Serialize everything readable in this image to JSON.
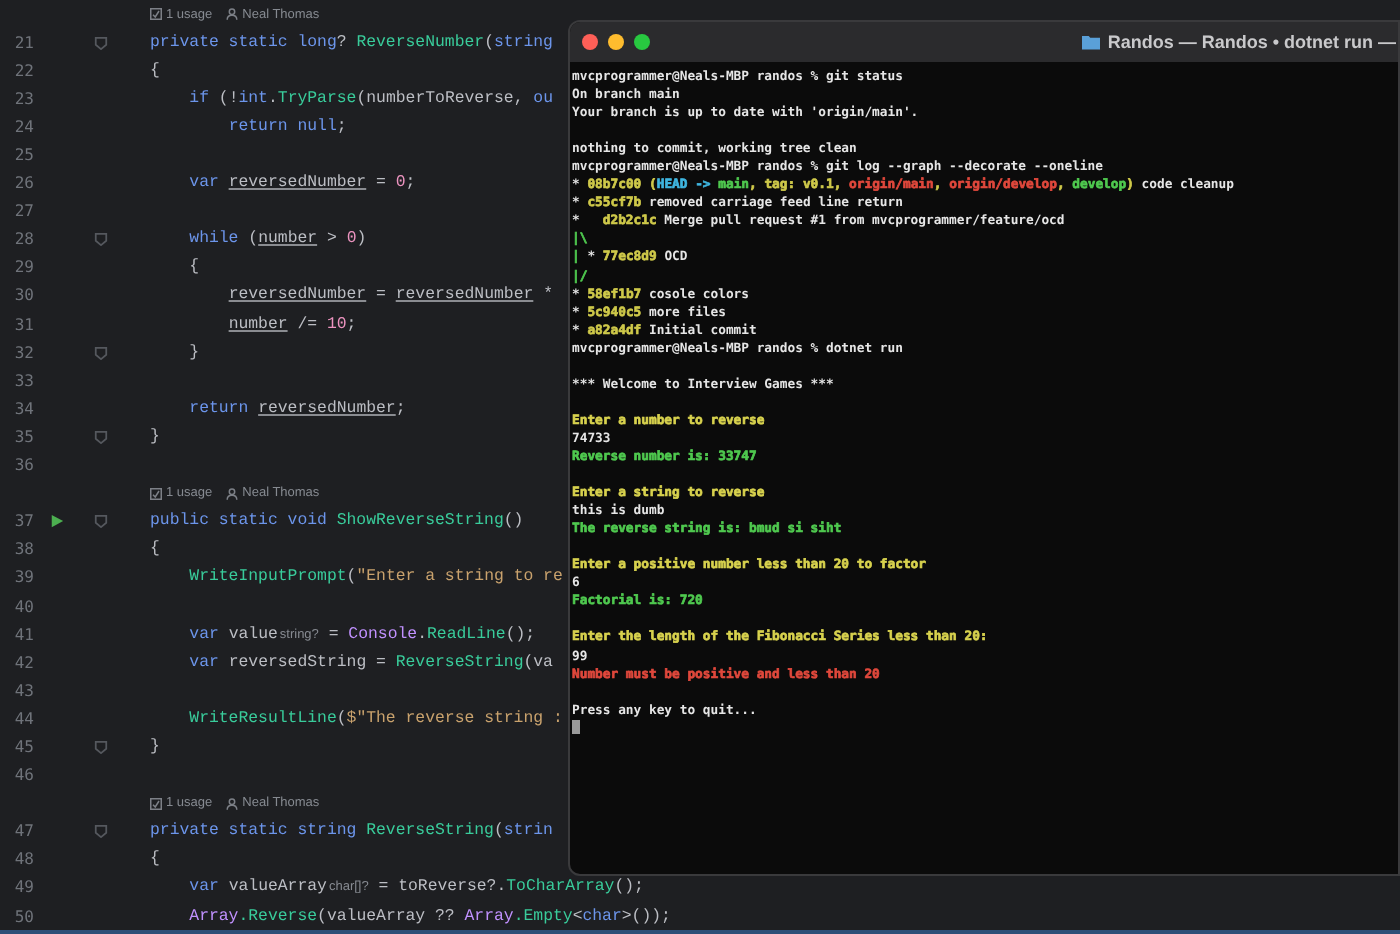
{
  "editor": {
    "rows": [
      {
        "kind": "usage",
        "usages": "1 usage",
        "author": "Neal Thomas"
      },
      {
        "kind": "code",
        "number": "21",
        "fold": true,
        "run": false,
        "tokens": [
          {
            "text": "private static long",
            "kind": "keyword"
          },
          {
            "text": "? ",
            "kind": "plain"
          },
          {
            "text": "ReverseNumber",
            "kind": "method"
          },
          {
            "text": "(",
            "kind": "plain"
          },
          {
            "text": "string",
            "kind": "keyword"
          }
        ]
      },
      {
        "kind": "code",
        "number": "22",
        "fold": false,
        "run": false,
        "tokens": [
          {
            "text": "{",
            "kind": "plain"
          }
        ]
      },
      {
        "kind": "code",
        "number": "23",
        "fold": false,
        "run": false,
        "tokens": [
          {
            "text": "    if",
            "kind": "keyword"
          },
          {
            "text": " (!",
            "kind": "plain"
          },
          {
            "text": "int",
            "kind": "keyword"
          },
          {
            "text": ".",
            "kind": "plain"
          },
          {
            "text": "TryParse",
            "kind": "method"
          },
          {
            "text": "(numberToReverse, ",
            "kind": "plain"
          },
          {
            "text": "ou",
            "kind": "keyword"
          }
        ]
      },
      {
        "kind": "code",
        "number": "24",
        "fold": false,
        "run": false,
        "tokens": [
          {
            "text": "        return null",
            "kind": "keyword"
          },
          {
            "text": ";",
            "kind": "plain"
          }
        ]
      },
      {
        "kind": "code",
        "number": "25",
        "fold": false,
        "run": false
      },
      {
        "kind": "code",
        "number": "26",
        "fold": false,
        "run": false,
        "tokens": [
          {
            "text": "    var ",
            "kind": "keyword"
          },
          {
            "text": "reversedNumber",
            "kind": "mutable"
          },
          {
            "text": " = ",
            "kind": "plain"
          },
          {
            "text": "0",
            "kind": "number"
          },
          {
            "text": ";",
            "kind": "plain"
          }
        ]
      },
      {
        "kind": "code",
        "number": "27",
        "fold": false,
        "run": false
      },
      {
        "kind": "code",
        "number": "28",
        "fold": true,
        "run": false,
        "tokens": [
          {
            "text": "    while",
            "kind": "keyword"
          },
          {
            "text": " (",
            "kind": "plain"
          },
          {
            "text": "number",
            "kind": "mutable"
          },
          {
            "text": " > ",
            "kind": "plain"
          },
          {
            "text": "0",
            "kind": "number"
          },
          {
            "text": ")",
            "kind": "plain"
          }
        ]
      },
      {
        "kind": "code",
        "number": "29",
        "fold": false,
        "run": false,
        "tokens": [
          {
            "text": "    {",
            "kind": "plain"
          }
        ]
      },
      {
        "kind": "code",
        "number": "30",
        "fold": false,
        "run": false,
        "tokens": [
          {
            "text": "        reversedNumber",
            "kind": "mutable"
          },
          {
            "text": " = ",
            "kind": "plain"
          },
          {
            "text": "reversedNumber",
            "kind": "mutable"
          },
          {
            "text": " *",
            "kind": "plain"
          }
        ]
      },
      {
        "kind": "code",
        "number": "31",
        "fold": false,
        "run": false,
        "tokens": [
          {
            "text": "        number",
            "kind": "mutable"
          },
          {
            "text": " /= ",
            "kind": "plain"
          },
          {
            "text": "10",
            "kind": "number"
          },
          {
            "text": ";",
            "kind": "plain"
          }
        ]
      },
      {
        "kind": "code",
        "number": "32",
        "fold": true,
        "run": false,
        "tokens": [
          {
            "text": "    }",
            "kind": "plain"
          }
        ]
      },
      {
        "kind": "code",
        "number": "33",
        "fold": false,
        "run": false
      },
      {
        "kind": "code",
        "number": "34",
        "fold": false,
        "run": false,
        "tokens": [
          {
            "text": "    return ",
            "kind": "keyword"
          },
          {
            "text": "reversedNumber",
            "kind": "mutable"
          },
          {
            "text": ";",
            "kind": "plain"
          }
        ]
      },
      {
        "kind": "code",
        "number": "35",
        "fold": true,
        "run": false,
        "tokens": [
          {
            "text": "}",
            "kind": "plain"
          }
        ]
      },
      {
        "kind": "code",
        "number": "36",
        "fold": false,
        "run": false
      },
      {
        "kind": "usage",
        "usages": "1 usage",
        "author": "Neal Thomas"
      },
      {
        "kind": "code",
        "number": "37",
        "fold": true,
        "run": true,
        "tokens": [
          {
            "text": "public static void ",
            "kind": "keyword"
          },
          {
            "text": "ShowReverseString",
            "kind": "method"
          },
          {
            "text": "()",
            "kind": "plain"
          }
        ]
      },
      {
        "kind": "code",
        "number": "38",
        "fold": false,
        "run": false,
        "tokens": [
          {
            "text": "{",
            "kind": "plain"
          }
        ]
      },
      {
        "kind": "code",
        "number": "39",
        "fold": false,
        "run": false,
        "tokens": [
          {
            "text": "    WriteInputPrompt",
            "kind": "method"
          },
          {
            "text": "(",
            "kind": "plain"
          },
          {
            "text": "\"Enter a string to re",
            "kind": "string"
          }
        ]
      },
      {
        "kind": "code",
        "number": "40",
        "fold": false,
        "run": false
      },
      {
        "kind": "code",
        "number": "41",
        "fold": false,
        "run": false,
        "tokens": [
          {
            "text": "    var",
            "kind": "keyword"
          },
          {
            "text": " value",
            "kind": "plain"
          },
          {
            "text": "string?",
            "kind": "hint"
          },
          {
            "text": " = ",
            "kind": "plain"
          },
          {
            "text": "Console",
            "kind": "class"
          },
          {
            "text": ".",
            "kind": "plain"
          },
          {
            "text": "ReadLine",
            "kind": "method"
          },
          {
            "text": "();",
            "kind": "plain"
          }
        ]
      },
      {
        "kind": "code",
        "number": "42",
        "fold": false,
        "run": false,
        "tokens": [
          {
            "text": "    var",
            "kind": "keyword"
          },
          {
            "text": " reversedString = ",
            "kind": "plain"
          },
          {
            "text": "ReverseString",
            "kind": "method"
          },
          {
            "text": "(va",
            "kind": "plain"
          }
        ]
      },
      {
        "kind": "code",
        "number": "43",
        "fold": false,
        "run": false
      },
      {
        "kind": "code",
        "number": "44",
        "fold": false,
        "run": false,
        "tokens": [
          {
            "text": "    WriteResultLine",
            "kind": "method"
          },
          {
            "text": "(",
            "kind": "plain"
          },
          {
            "text": "$\"The reverse string :",
            "kind": "string"
          }
        ]
      },
      {
        "kind": "code",
        "number": "45",
        "fold": true,
        "run": false,
        "tokens": [
          {
            "text": "}",
            "kind": "plain"
          }
        ]
      },
      {
        "kind": "code",
        "number": "46",
        "fold": false,
        "run": false
      },
      {
        "kind": "usage",
        "usages": "1 usage",
        "author": "Neal Thomas"
      },
      {
        "kind": "code",
        "number": "47",
        "fold": true,
        "run": false,
        "tokens": [
          {
            "text": "private static string ",
            "kind": "keyword"
          },
          {
            "text": "ReverseString",
            "kind": "method"
          },
          {
            "text": "(",
            "kind": "plain"
          },
          {
            "text": "strin",
            "kind": "keyword"
          }
        ]
      },
      {
        "kind": "code",
        "number": "48",
        "fold": false,
        "run": false,
        "tokens": [
          {
            "text": "{",
            "kind": "plain"
          }
        ]
      },
      {
        "kind": "code",
        "number": "49",
        "fold": false,
        "run": false,
        "tokens": [
          {
            "text": "    var",
            "kind": "keyword"
          },
          {
            "text": " valueArray",
            "kind": "plain"
          },
          {
            "text": "char[]?",
            "kind": "hint"
          },
          {
            "text": " = toReverse?.",
            "kind": "plain"
          },
          {
            "text": "ToCharArray",
            "kind": "method"
          },
          {
            "text": "();",
            "kind": "plain"
          }
        ]
      },
      {
        "kind": "code",
        "number": "50",
        "fold": false,
        "run": false,
        "tokens": [
          {
            "text": "    Array",
            "kind": "class"
          },
          {
            "text": ".Reverse",
            "kind": "method"
          },
          {
            "text": "(valueArray ?? ",
            "kind": "plain"
          },
          {
            "text": "Array",
            "kind": "class"
          },
          {
            "text": ".Empty",
            "kind": "method"
          },
          {
            "text": "<",
            "kind": "plain"
          },
          {
            "text": "char",
            "kind": "keyword"
          },
          {
            "text": ">());",
            "kind": "plain"
          }
        ]
      }
    ]
  },
  "terminal": {
    "title": "Randos — Randos • dotnet run —",
    "cursor": true,
    "blocks": [
      {
        "lines": [
          {
            "segments": [
              {
                "text": "mvcprogrammer@Neals-MBP randos % git status"
              }
            ]
          },
          {
            "segments": [
              {
                "text": "On branch main"
              }
            ]
          },
          {
            "segments": [
              {
                "text": "Your branch is up to date with 'origin/main'."
              }
            ]
          }
        ]
      },
      {
        "lines": [
          {
            "segments": [
              {
                "text": "nothing to commit, working tree clean"
              }
            ]
          },
          {
            "segments": [
              {
                "text": "mvcprogrammer@Neals-MBP randos % git log --graph --decorate --oneline"
              }
            ]
          },
          {
            "segments": [
              {
                "text": "* "
              },
              {
                "text": "08b7c00 (",
                "color": "#cfc94a"
              },
              {
                "text": "HEAD -> ",
                "color": "#3fb6e0"
              },
              {
                "text": "main",
                "color": "#4fc94f"
              },
              {
                "text": ", tag: v0.1, ",
                "color": "#cfc94a"
              },
              {
                "text": "origin/main",
                "color": "#e0483c"
              },
              {
                "text": ", ",
                "color": "#cfc94a"
              },
              {
                "text": "origin/develop",
                "color": "#e0483c"
              },
              {
                "text": ", ",
                "color": "#cfc94a"
              },
              {
                "text": "develop",
                "color": "#4fc94f"
              },
              {
                "text": ")",
                "color": "#cfc94a"
              },
              {
                "text": " code cleanup"
              }
            ]
          },
          {
            "segments": [
              {
                "text": "* "
              },
              {
                "text": "c55cf7b",
                "color": "#cfc94a"
              },
              {
                "text": " removed carriage feed line return"
              }
            ]
          },
          {
            "segments": [
              {
                "text": "*   "
              },
              {
                "text": "d2b2c1c",
                "color": "#cfc94a"
              },
              {
                "text": " Merge pull request #1 from mvcprogrammer/feature/ocd"
              }
            ]
          },
          {
            "segments": [
              {
                "text": "|\\",
                "color": "#4fc94f"
              }
            ]
          },
          {
            "segments": [
              {
                "text": "|",
                "color": "#4fc94f"
              },
              {
                "text": " * "
              },
              {
                "text": "77ec8d9",
                "color": "#cfc94a"
              },
              {
                "text": " OCD"
              }
            ]
          },
          {
            "segments": [
              {
                "text": "|/",
                "color": "#4fc94f"
              }
            ]
          },
          {
            "segments": [
              {
                "text": "* "
              },
              {
                "text": "58ef1b7",
                "color": "#cfc94a"
              },
              {
                "text": " cosole colors"
              }
            ]
          },
          {
            "segments": [
              {
                "text": "* "
              },
              {
                "text": "5c940c5",
                "color": "#cfc94a"
              },
              {
                "text": " more files"
              }
            ]
          },
          {
            "segments": [
              {
                "text": "* "
              },
              {
                "text": "a82a4df",
                "color": "#cfc94a"
              },
              {
                "text": " Initial commit"
              }
            ]
          },
          {
            "segments": [
              {
                "text": "mvcprogrammer@Neals-MBP randos % dotnet run"
              }
            ]
          }
        ]
      },
      {
        "lines": [
          {
            "segments": [
              {
                "text": "*** Welcome to Interview Games ***"
              }
            ]
          }
        ]
      },
      {
        "lines": [
          {
            "segments": [
              {
                "text": "Enter a number to reverse",
                "color": "#d8d24e"
              }
            ]
          },
          {
            "segments": [
              {
                "text": "74733"
              }
            ]
          },
          {
            "segments": [
              {
                "text": "Reverse number is: 33747",
                "color": "#4fc94f"
              }
            ]
          }
        ]
      },
      {
        "lines": [
          {
            "segments": [
              {
                "text": "Enter a string to reverse",
                "color": "#d8d24e"
              }
            ]
          },
          {
            "segments": [
              {
                "text": "this is dumb"
              }
            ]
          },
          {
            "segments": [
              {
                "text": "The reverse string is: bmud si siht",
                "color": "#4fc94f"
              }
            ]
          }
        ]
      },
      {
        "lines": [
          {
            "segments": [
              {
                "text": "Enter a positive number less than 20 to factor",
                "color": "#d8d24e"
              }
            ]
          },
          {
            "segments": [
              {
                "text": "6"
              }
            ]
          },
          {
            "segments": [
              {
                "text": "Factorial is: 720",
                "color": "#4fc94f"
              }
            ]
          }
        ]
      },
      {
        "lines": [
          {
            "segments": [
              {
                "text": "Enter the length of the Fibonacci Series less than 20:",
                "color": "#d8d24e"
              }
            ]
          },
          {
            "segments": [
              {
                "text": "99"
              }
            ]
          },
          {
            "segments": [
              {
                "text": "Number must be positive and less than 20",
                "color": "#e0483c"
              }
            ]
          }
        ]
      },
      {
        "lines": [
          {
            "segments": [
              {
                "text": "Press any key to quit..."
              }
            ]
          }
        ]
      }
    ]
  }
}
